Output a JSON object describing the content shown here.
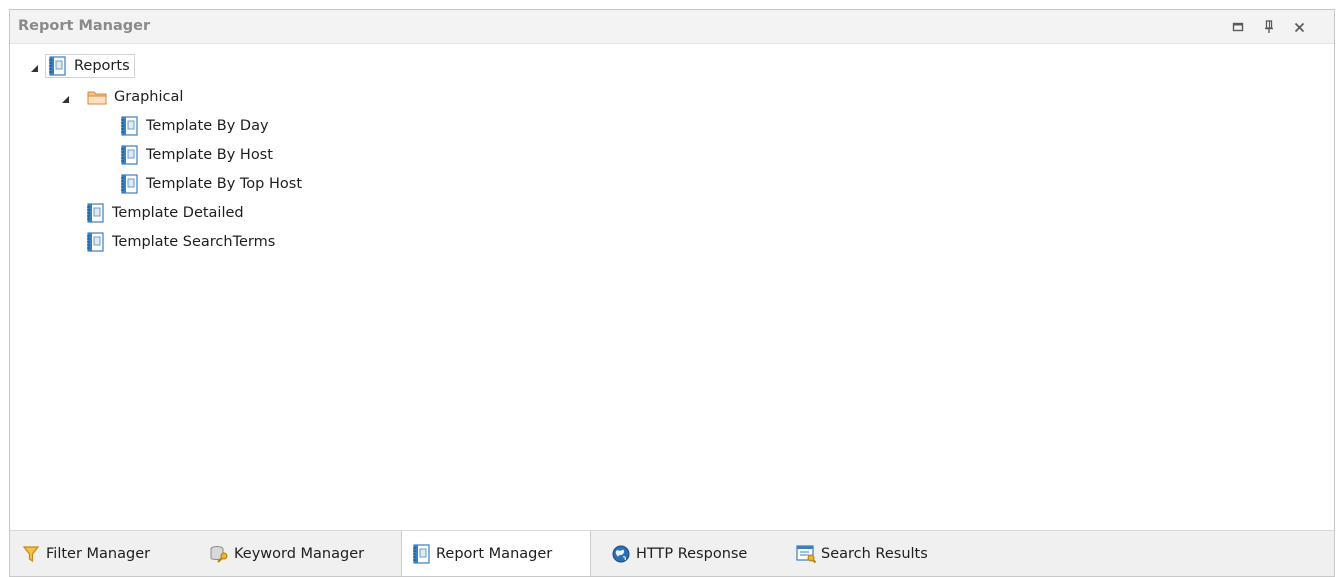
{
  "panel": {
    "title": "Report Manager",
    "buttons": {
      "maximize_icon": "maximize-icon",
      "pin_icon": "pin-icon",
      "close_icon": "close-icon"
    }
  },
  "tree": {
    "root": {
      "label": "Reports",
      "icon": "report-icon",
      "expanded": true
    },
    "folder": {
      "label": "Graphical",
      "icon": "folder-icon",
      "expanded": true
    },
    "items": [
      {
        "label": "Template By Day",
        "icon": "report-icon"
      },
      {
        "label": "Template By Host",
        "icon": "report-icon"
      },
      {
        "label": "Template By Top Host",
        "icon": "report-icon"
      },
      {
        "label": "Template Detailed",
        "icon": "report-icon"
      },
      {
        "label": "Template SearchTerms",
        "icon": "report-icon"
      }
    ]
  },
  "tabs": [
    {
      "label": "Filter Manager",
      "icon": "filter-icon",
      "active": false
    },
    {
      "label": "Keyword Manager",
      "icon": "keyword-icon",
      "active": false
    },
    {
      "label": "Report Manager",
      "icon": "report-icon",
      "active": true
    },
    {
      "label": "HTTP Response",
      "icon": "globe-icon",
      "active": false
    },
    {
      "label": "Search Results",
      "icon": "search-results-icon",
      "active": false
    }
  ],
  "colors": {
    "accent_blue": "#3a7fc1",
    "folder_orange": "#f0a860",
    "filter_yellow": "#e8a317"
  }
}
